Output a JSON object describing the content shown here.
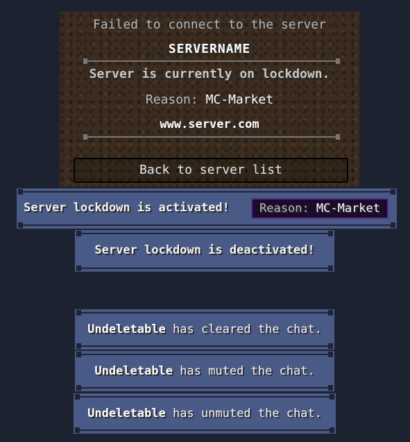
{
  "disconnect": {
    "title": "Failed to connect to the server",
    "server_name": "SERVERNAME",
    "lockdown_message": "Server is currently on lockdown.",
    "reason_key": "Reason:",
    "reason_value": "MC-Market",
    "website": "www.server.com",
    "back_button": "Back to server list"
  },
  "messages": {
    "activated": "Server lockdown is activated!",
    "activated_reason_key": "Reason:",
    "activated_reason_value": "MC-Market",
    "deactivated": "Server lockdown is deactivated!",
    "cleared_user": "Undeletable",
    "cleared_text": "has cleared the chat.",
    "muted_user": "Undeletable",
    "muted_text": "has muted the chat.",
    "unmuted_user": "Undeletable",
    "unmuted_text": "has unmuted the chat."
  },
  "colors": {
    "background": "#1c2230",
    "banner": "#4a5a86",
    "dirt": "#3b2c1f",
    "reason_box": "#1a0b2a"
  }
}
